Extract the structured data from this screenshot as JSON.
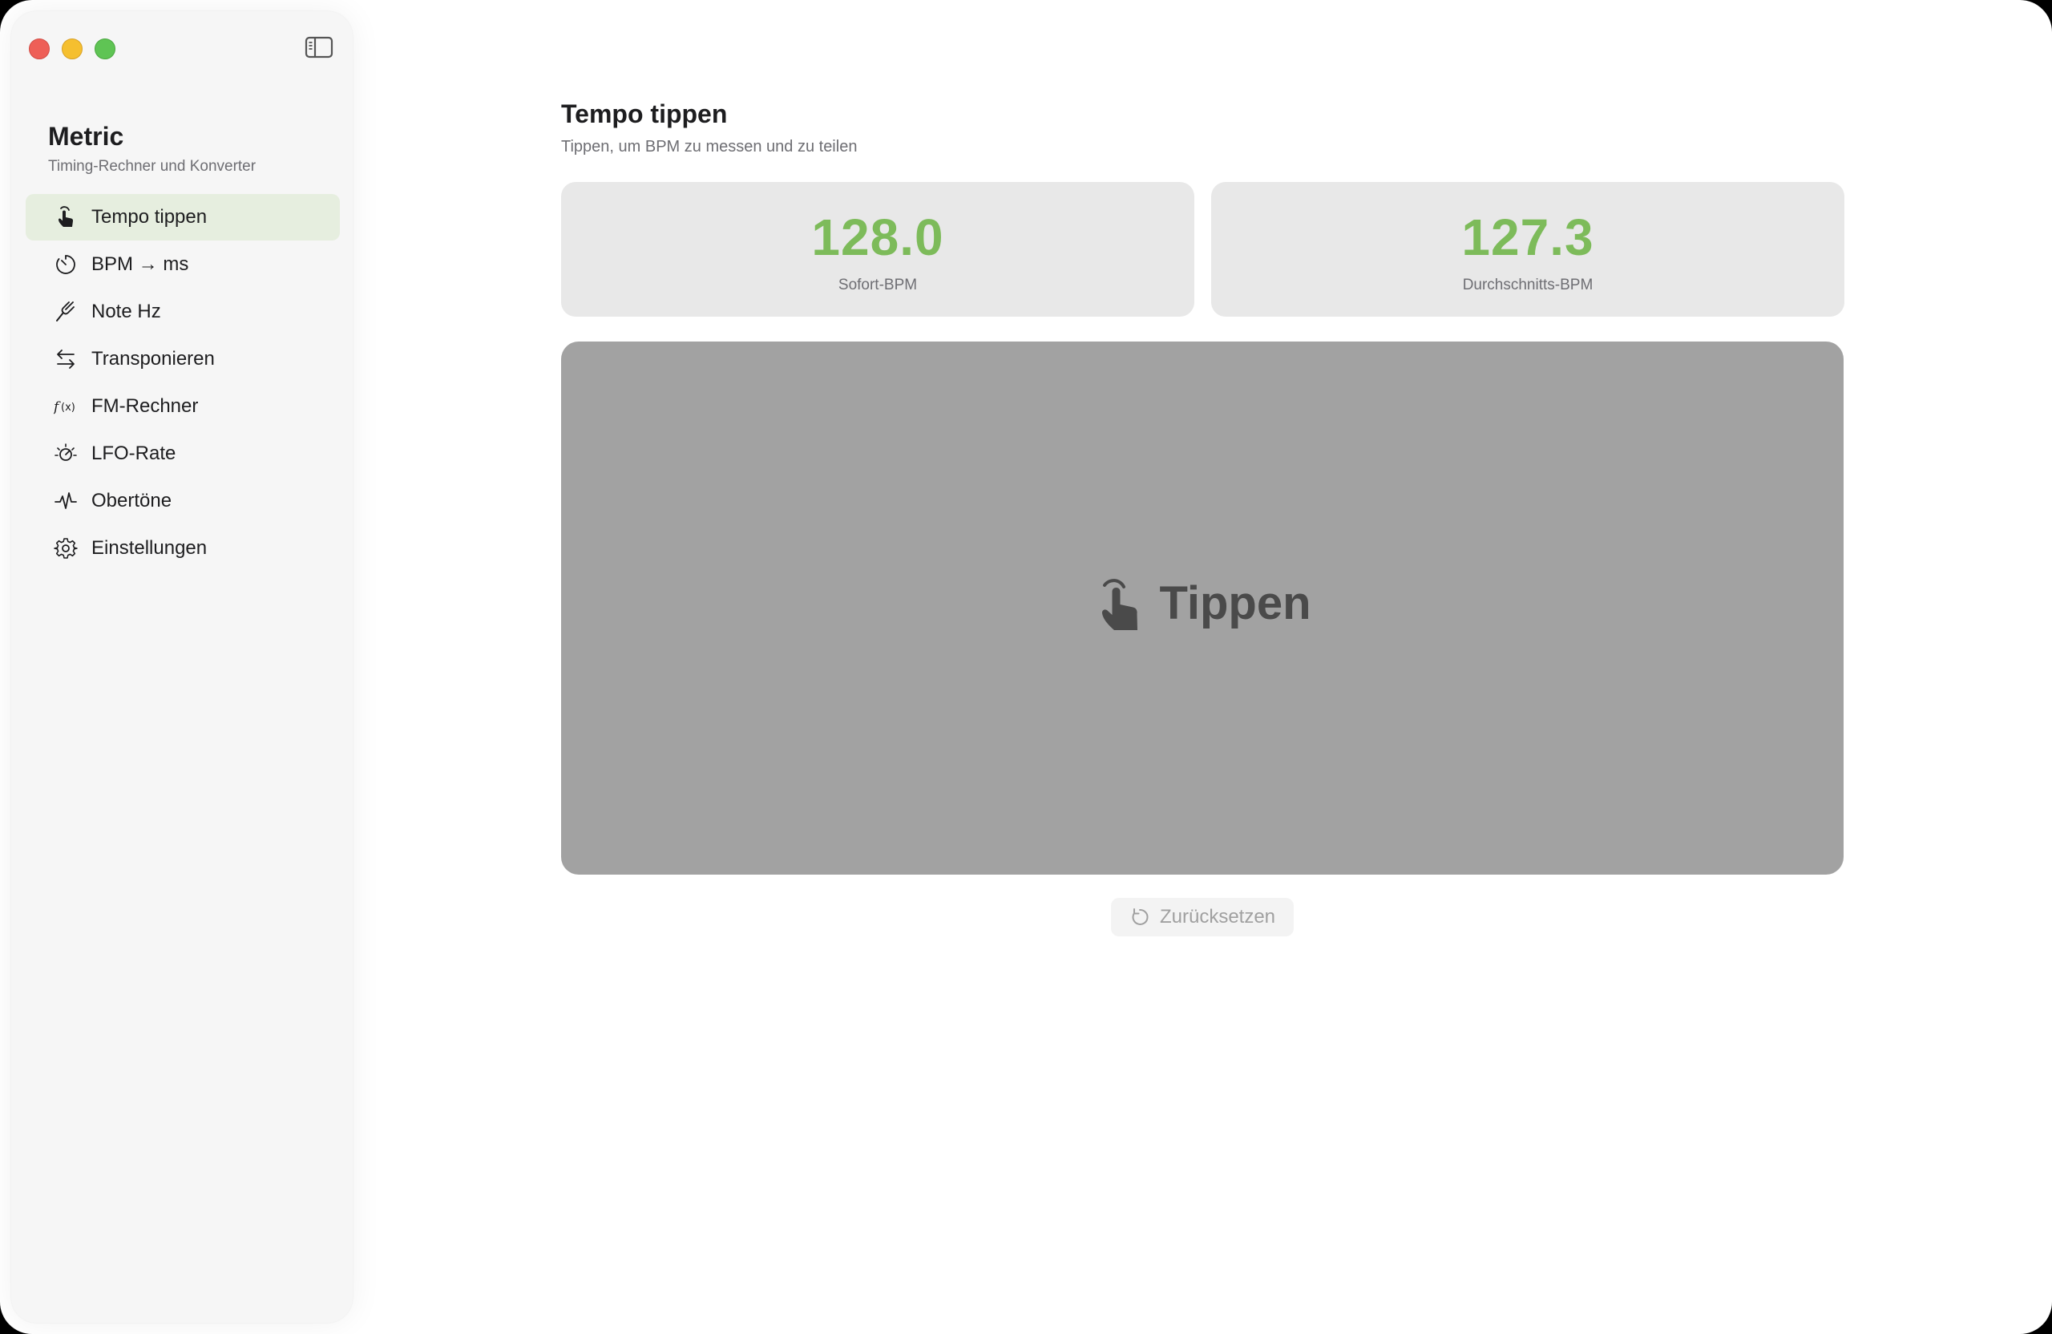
{
  "window": {
    "traffic_lights": [
      "close",
      "minimize",
      "zoom"
    ]
  },
  "sidebar": {
    "app_title": "Metric",
    "app_subtitle": "Timing-Rechner und Konverter",
    "toggle_icon": "sidebar-toggle-icon",
    "items": [
      {
        "label": "Tempo tippen",
        "icon": "tap-hand-icon",
        "active": true
      },
      {
        "label": "BPM → ms",
        "icon": "timer-icon",
        "active": false
      },
      {
        "label": "Note Hz",
        "icon": "tuning-fork-icon",
        "active": false
      },
      {
        "label": "Transponieren",
        "icon": "arrows-swap-icon",
        "active": false
      },
      {
        "label": "FM-Rechner",
        "icon": "function-icon",
        "active": false
      },
      {
        "label": "LFO-Rate",
        "icon": "dial-icon",
        "active": false
      },
      {
        "label": "Obertöne",
        "icon": "waveform-icon",
        "active": false
      },
      {
        "label": "Einstellungen",
        "icon": "gear-icon",
        "active": false
      }
    ]
  },
  "main": {
    "title": "Tempo tippen",
    "subtitle": "Tippen, um BPM zu messen und zu teilen",
    "stats": [
      {
        "value": "128.0",
        "label": "Sofort-BPM"
      },
      {
        "value": "127.3",
        "label": "Durchschnitts-BPM"
      }
    ],
    "tap_pad": {
      "label": "Tippen",
      "icon": "tap-hand-icon"
    },
    "reset_button": {
      "label": "Zurücksetzen",
      "icon": "reset-icon"
    }
  },
  "colors": {
    "accent_green": "#7dbb5a",
    "active_item_bg": "#e6eedf",
    "tap_pad_bg": "#a2a2a2",
    "stat_card_bg": "#e8e8e8"
  }
}
